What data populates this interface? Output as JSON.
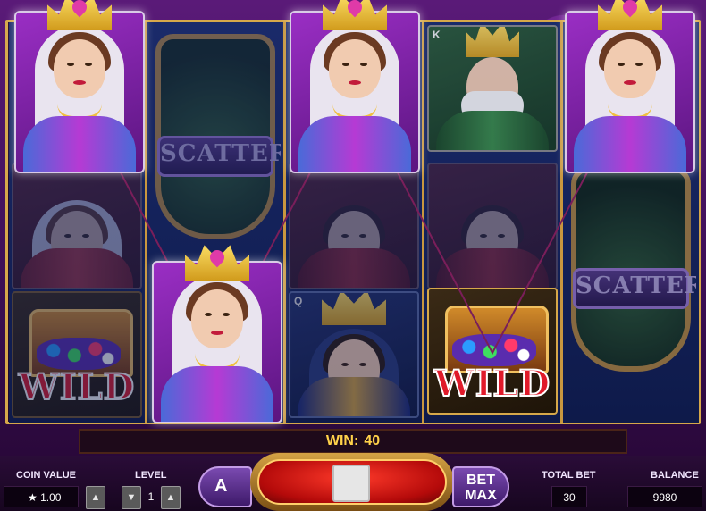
{
  "win": {
    "label": "WIN:",
    "amount": "40"
  },
  "controls": {
    "coin_value_label": "COIN VALUE",
    "coin_value_star": "★",
    "coin_value": "1.00",
    "level_label": "LEVEL",
    "level_value": "1",
    "total_bet_label": "TOTAL BET",
    "total_bet_value": "30",
    "balance_label": "BALANCE",
    "balance_value": "9980",
    "bet_max_top": "BET",
    "bet_max_bottom": "MAX",
    "auto_label": "A",
    "up_arrow": "▲",
    "down_arrow": "▼"
  },
  "symbols": {
    "scatter_label": "SCATTER",
    "wild_label": "WILD",
    "king_corner": "K",
    "queen_corner": "Q"
  },
  "reels": [
    [
      "queen-win",
      "queen-dim",
      "wild-dim"
    ],
    [
      "scatter-dim",
      "scatter-dim",
      "queen-win"
    ],
    [
      "queen-win",
      "jack-dim",
      "queen-blue-dim"
    ],
    [
      "king-dim",
      "jack-dim",
      "wild"
    ],
    [
      "queen-win",
      "scatter-dim",
      "scatter-dim"
    ]
  ],
  "colors": {
    "accent_gold": "#d6a84a",
    "win_text": "#ffd24a",
    "spin_red": "#d01a12",
    "background_purple": "#4a1566"
  }
}
